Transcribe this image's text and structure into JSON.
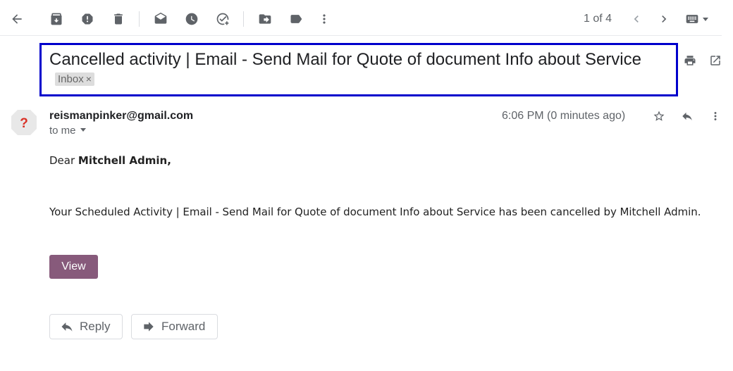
{
  "toolbar": {
    "icons": [
      "back-arrow-icon",
      "archive-icon",
      "report-spam-icon",
      "delete-icon",
      "mark-unread-icon",
      "snooze-icon",
      "add-task-icon",
      "move-to-icon",
      "label-icon",
      "more-vert-icon"
    ],
    "pager_text": "1 of 4",
    "pager_icons": [
      "chevron-left-icon",
      "chevron-right-icon"
    ],
    "input_tools_icon": "keyboard-icon"
  },
  "subject": {
    "title": "Cancelled activity | Email - Send Mail for Quote of document Info about Service",
    "label_chip": "Inbox",
    "label_remove": "×",
    "highlight_color": "#0000cc"
  },
  "header_actions": [
    "print-icon",
    "open-in-new-window-icon"
  ],
  "message": {
    "sender": "reismanpinker@gmail.com",
    "recipient_label": "to me",
    "timestamp": "6:06 PM (0 minutes ago)",
    "avatar_glyph": "?",
    "avatar_color": "#d93025",
    "actions": [
      "star-icon",
      "reply-icon",
      "more-vert-icon"
    ],
    "greeting_prefix": "Dear",
    "greeting_name": "Mitchell Admin,",
    "body": "Your Scheduled Activity | Email - Send Mail for Quote of document Info about Service has been cancelled by Mitchell Admin.",
    "view_button": "View",
    "view_button_color": "#875a7b"
  },
  "footer": {
    "reply_label": "Reply",
    "forward_label": "Forward"
  }
}
